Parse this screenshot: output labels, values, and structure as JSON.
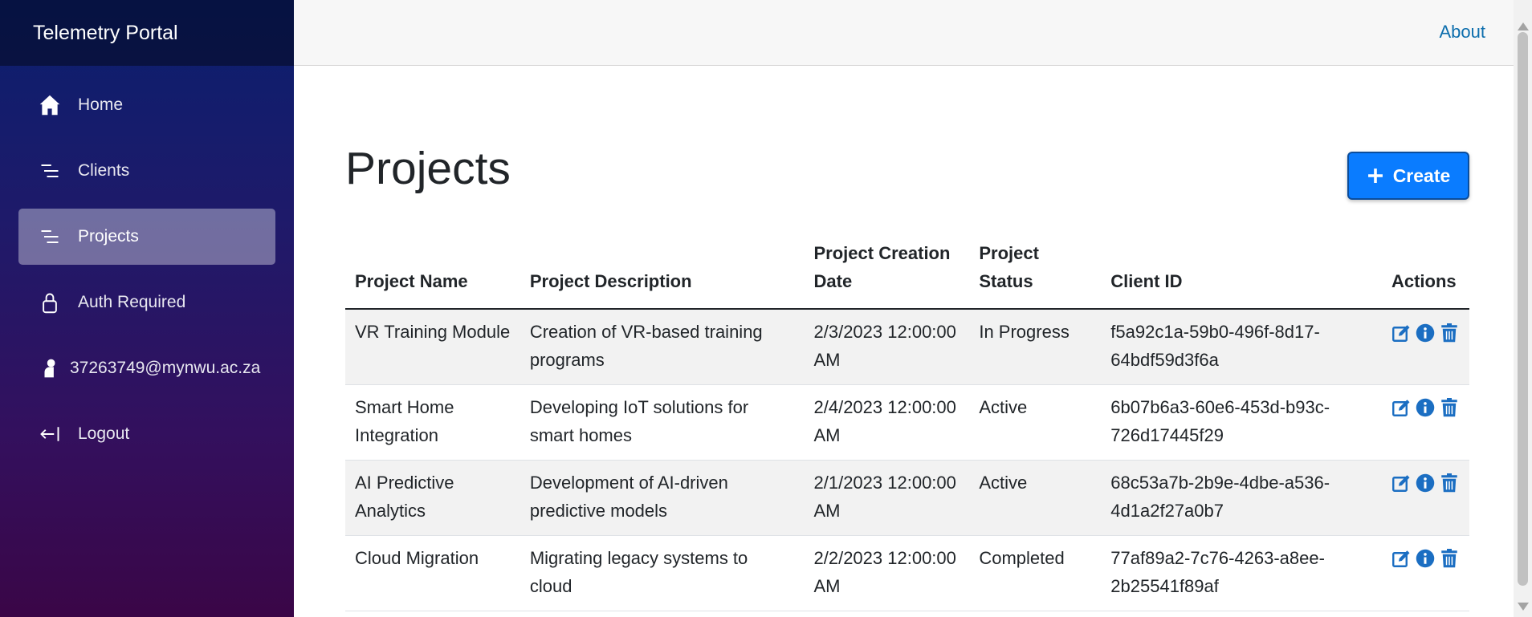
{
  "app": {
    "brand": "Telemetry Portal"
  },
  "sidebar": {
    "items": [
      {
        "label": "Home",
        "icon": "home-icon"
      },
      {
        "label": "Clients",
        "icon": "list-icon"
      },
      {
        "label": "Projects",
        "icon": "list-icon",
        "active": true
      },
      {
        "label": "Auth Required",
        "icon": "lock-icon"
      },
      {
        "label": "37263749@mynwu.ac.za",
        "icon": "user-icon"
      },
      {
        "label": "Logout",
        "icon": "logout-icon"
      }
    ]
  },
  "topbar": {
    "about_label": "About"
  },
  "page": {
    "title": "Projects",
    "create_label": "Create"
  },
  "table": {
    "headers": {
      "name": "Project Name",
      "description": "Project Description",
      "date": "Project Creation Date",
      "status": "Project Status",
      "client": "Client ID",
      "actions": "Actions"
    },
    "rows": [
      {
        "name": "VR Training Module",
        "description": "Creation of VR-based training programs",
        "date": "2/3/2023 12:00:00 AM",
        "status": "In Progress",
        "client": "f5a92c1a-59b0-496f-8d17-64bdf59d3f6a"
      },
      {
        "name": "Smart Home Integration",
        "description": "Developing IoT solutions for smart homes",
        "date": "2/4/2023 12:00:00 AM",
        "status": "Active",
        "client": "6b07b6a3-60e6-453d-b93c-726d17445f29"
      },
      {
        "name": "AI Predictive Analytics",
        "description": "Development of AI-driven predictive models",
        "date": "2/1/2023 12:00:00 AM",
        "status": "Active",
        "client": "68c53a7b-2b9e-4dbe-a536-4d1a2f27a0b7"
      },
      {
        "name": "Cloud Migration",
        "description": "Migrating legacy systems to cloud",
        "date": "2/2/2023 12:00:00 AM",
        "status": "Completed",
        "client": "77af89a2-7c76-4263-a8ee-2b25541f89af"
      }
    ]
  },
  "colors": {
    "accent": "#0a7cff",
    "link": "#0d6ead",
    "action_icon": "#1b6ec2"
  }
}
